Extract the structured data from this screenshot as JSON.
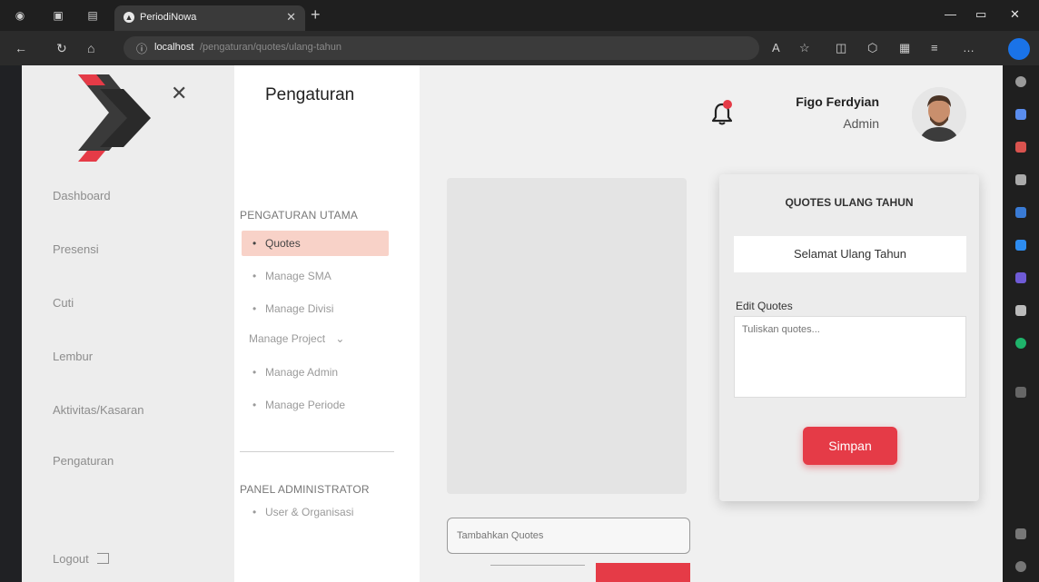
{
  "browser": {
    "tab_title": "PeriodiNowa",
    "url_host": "localhost",
    "url_path": "/pengaturan/quotes/ulang-tahun"
  },
  "sidebar": {
    "items": [
      {
        "label": "Dashboard"
      },
      {
        "label": "Presensi"
      },
      {
        "label": "Cuti"
      },
      {
        "label": "Lembur"
      },
      {
        "label": "Aktivitas/Kasaran"
      },
      {
        "label": "Pengaturan"
      }
    ],
    "logout_label": "Logout"
  },
  "settings": {
    "title": "Pengaturan",
    "main_section": "PENGATURAN UTAMA",
    "menu": [
      {
        "label": "Quotes",
        "active": true
      },
      {
        "label": "Manage SMA"
      },
      {
        "label": "Manage Divisi"
      }
    ],
    "manage_project_label": "Manage Project",
    "project_menu": [
      {
        "label": "Manage Admin"
      },
      {
        "label": "Manage Periode"
      }
    ],
    "admin_section": "PANEL ADMINISTRATOR",
    "admin_menu": [
      {
        "label": "User & Organisasi"
      }
    ]
  },
  "header": {
    "user_name": "Figo Ferdyian",
    "user_role": "Admin"
  },
  "main": {
    "add_quote_placeholder": "Tambahkan Quotes"
  },
  "quotes_card": {
    "title": "QUOTES ULANG TAHUN",
    "current_quote": "Selamat Ulang Tahun",
    "edit_label": "Edit Quotes",
    "textarea_placeholder": "Tuliskan quotes...",
    "save_label": "Simpan"
  },
  "colors": {
    "accent": "#e53b47",
    "active_menu_bg": "#f8d2c8"
  }
}
